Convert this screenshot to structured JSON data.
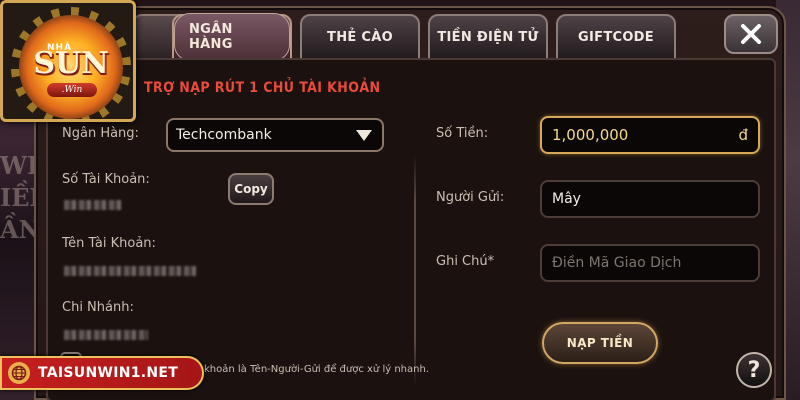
{
  "tabs": [
    {
      "label": "NGÂN HÀNG",
      "active": true
    },
    {
      "label": "THẺ CÀO",
      "active": false
    },
    {
      "label": "TIỀN ĐIỆN TỬ",
      "active": false
    },
    {
      "label": "GIFTCODE",
      "active": false
    }
  ],
  "banner": "TRỢ NẠP RÚT 1 CHỦ TÀI KHOẢN",
  "left": {
    "bank_label": "Ngân Hàng:",
    "bank_value": "Techcombank",
    "account_no_label": "Số Tài Khoản:",
    "copy_label": "Copy",
    "account_name_label": "Tên Tài Khoản:",
    "branch_label": "Chi Nhánh:"
  },
  "right": {
    "amount_label": "Số Tiền:",
    "amount_value": "1,000,000",
    "currency": "đ",
    "sender_label": "Người Gửi:",
    "sender_value": "Mây",
    "note_label": "Ghi Chú*",
    "note_placeholder": "Điền Mã Giao Dịch"
  },
  "submit_label": "NẠP TIỀN",
  "help_label": "?",
  "footnote": "khoản là Tên-Người-Gửi để được xử lý nhanh.",
  "logo": {
    "word": "SUN",
    "sub": ".Win",
    "top": "NHÀ"
  },
  "site_badge": "TAISUNWIN1.NET",
  "background_text": "WI\nIỀN\nẦN",
  "colors": {
    "accent_gold": "#d7a85a",
    "banner_red": "#e94b3c",
    "badge_red": "#c61f1f"
  },
  "icons": {
    "close": "close-icon",
    "dropdown": "chevron-down-icon",
    "help": "help-icon",
    "globe": "globe-icon"
  }
}
